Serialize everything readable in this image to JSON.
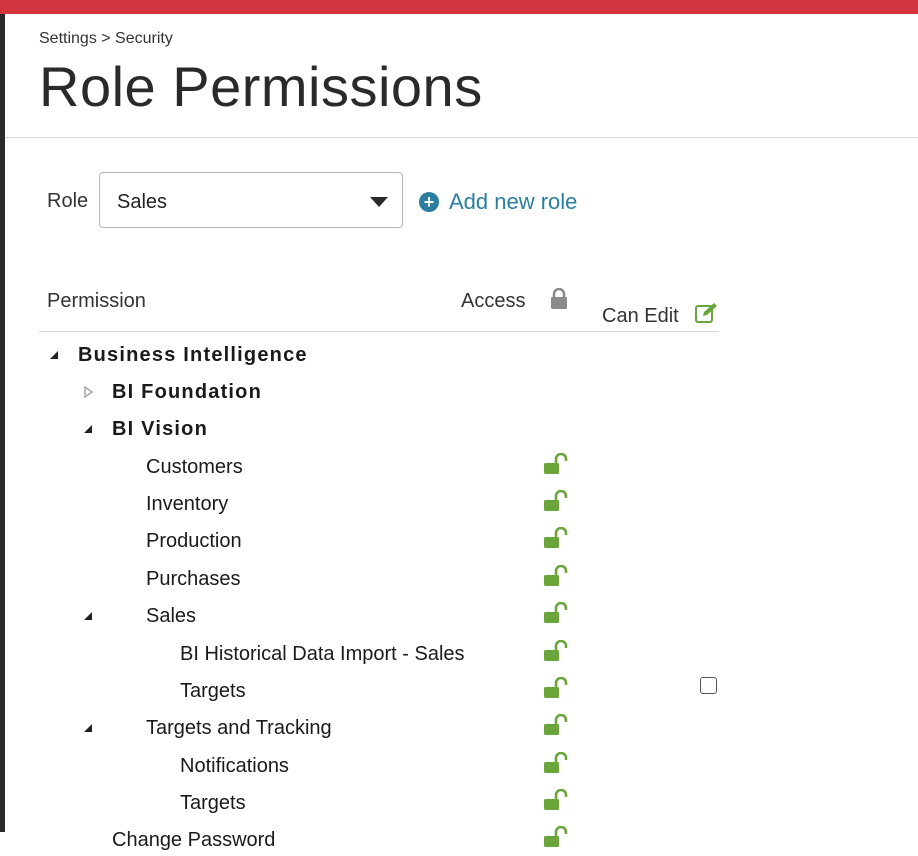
{
  "colors": {
    "accent_red": "#d3323f",
    "link_blue": "#2a7fa1",
    "lock_green": "#6aa53b",
    "lock_gray": "#8a8a8a"
  },
  "breadcrumb": "Settings > Security",
  "title": "Role Permissions",
  "role": {
    "label": "Role",
    "selected": "Sales",
    "add_new_label": "Add new role",
    "add_icon": "plus-circle-icon"
  },
  "table": {
    "headers": {
      "permission": "Permission",
      "access": "Access",
      "can_edit": "Can Edit"
    },
    "header_icons": {
      "access": "lock-icon",
      "can_edit": "edit-icon"
    },
    "rows": [
      {
        "label": "Business Intelligence",
        "level": 0,
        "toggle": "expanded",
        "bold": true,
        "lock": false,
        "checkbox": false
      },
      {
        "label": "BI Foundation",
        "level": 1,
        "toggle": "collapsed",
        "bold": true,
        "lock": false,
        "checkbox": false
      },
      {
        "label": "BI Vision",
        "level": 1,
        "toggle": "expanded",
        "bold": true,
        "lock": false,
        "checkbox": false
      },
      {
        "label": "Customers",
        "level": 2,
        "toggle": "none",
        "bold": false,
        "lock": true,
        "checkbox": false
      },
      {
        "label": "Inventory",
        "level": 2,
        "toggle": "none",
        "bold": false,
        "lock": true,
        "checkbox": false
      },
      {
        "label": "Production",
        "level": 2,
        "toggle": "none",
        "bold": false,
        "lock": true,
        "checkbox": false
      },
      {
        "label": "Purchases",
        "level": 2,
        "toggle": "none",
        "bold": false,
        "lock": true,
        "checkbox": false
      },
      {
        "label": "Sales",
        "level": 2,
        "toggle": "expanded",
        "bold": false,
        "lock": true,
        "checkbox": false
      },
      {
        "label": "BI Historical Data Import - Sales",
        "level": 3,
        "toggle": "none",
        "bold": false,
        "lock": true,
        "checkbox": false
      },
      {
        "label": "Targets",
        "level": 3,
        "toggle": "none",
        "bold": false,
        "lock": true,
        "checkbox": true
      },
      {
        "label": "Targets and Tracking",
        "level": 2,
        "toggle": "expanded",
        "bold": false,
        "lock": true,
        "checkbox": false
      },
      {
        "label": "Notifications",
        "level": 3,
        "toggle": "none",
        "bold": false,
        "lock": true,
        "checkbox": false
      },
      {
        "label": "Targets",
        "level": 3,
        "toggle": "none",
        "bold": false,
        "lock": true,
        "checkbox": false
      },
      {
        "label": "Change Password",
        "level": 1,
        "toggle": "none",
        "bold": false,
        "lock": true,
        "checkbox": false
      }
    ]
  }
}
